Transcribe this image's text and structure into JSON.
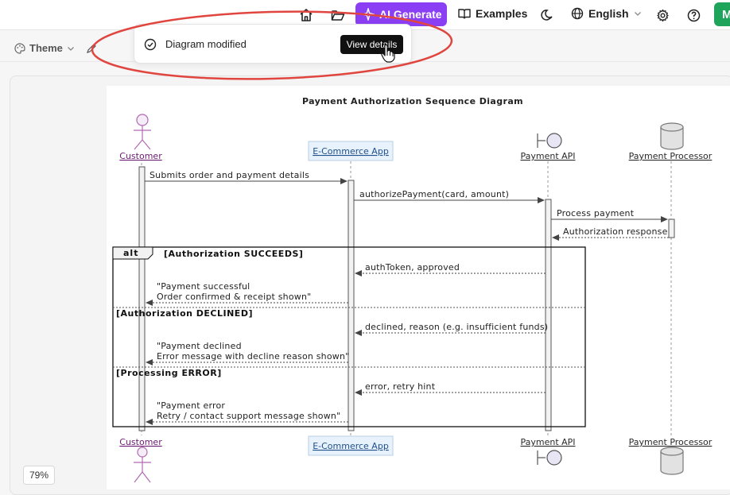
{
  "nav": {
    "ai_generate": "AI Generate",
    "examples": "Examples",
    "language": "English",
    "avatar_initial": "M"
  },
  "toolbar": {
    "theme": "Theme"
  },
  "toast": {
    "message": "Diagram modified",
    "button": "View details"
  },
  "colors": {
    "accent": "#8b3ff4",
    "callout": "#e0463f",
    "avatar": "#1fa55b",
    "actor": "#b06ab3",
    "participant_box": "#e8f2fc"
  },
  "diagram": {
    "title": "Payment Authorization Sequence Diagram",
    "participants": {
      "customer": "Customer",
      "app": "E-Commerce App",
      "api": "Payment API",
      "processor": "Payment Processor"
    },
    "messages": {
      "m1": "Submits order and payment details",
      "m2": "authorizePayment(card, amount)",
      "m3": "Process payment",
      "m4": "Authorization response",
      "m5": "authToken, approved",
      "m6a": "\"Payment successful",
      "m6b": "Order confirmed & receipt shown\"",
      "m7": "declined, reason (e.g. insufficient funds)",
      "m8a": "\"Payment declined",
      "m8b": "Error message with decline reason shown\"",
      "m9": "error, retry hint",
      "m10a": "\"Payment error",
      "m10b": "Retry / contact support message shown\""
    },
    "alt": {
      "keyword": "alt",
      "g1": "[Authorization SUCCEEDS]",
      "g2": "[Authorization DECLINED]",
      "g3": "[Processing ERROR]"
    }
  },
  "zoom": "79%"
}
